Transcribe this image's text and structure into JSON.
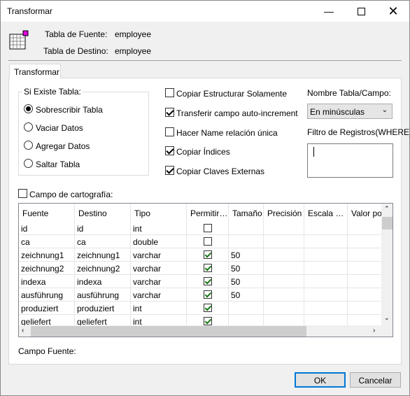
{
  "window": {
    "title": "Transformar",
    "minimize_icon": "minimize-icon",
    "maximize_icon": "maximize-icon",
    "close_icon": "close-icon"
  },
  "header": {
    "icon": "table-icon",
    "source_label": "Tabla de Fuente:",
    "source_value": "employee",
    "dest_label": "Tabla de Destino:",
    "dest_value": "employee"
  },
  "tabs": [
    {
      "label": "Transformar",
      "active": true
    }
  ],
  "if_exists": {
    "label": "Si Existe Tabla:",
    "options": [
      {
        "label": "Sobrescribir Tabla",
        "selected": true
      },
      {
        "label": "Vaciar Datos",
        "selected": false
      },
      {
        "label": "Agregar Datos",
        "selected": false
      },
      {
        "label": "Saltar Tabla",
        "selected": false
      }
    ]
  },
  "options": [
    {
      "label": "Copiar Estructurar Solamente",
      "checked": false
    },
    {
      "label": "Transferir campo auto-increment",
      "checked": true
    },
    {
      "label": "Hacer Name relación única",
      "checked": false
    },
    {
      "label": "Copiar Índices",
      "checked": true
    },
    {
      "label": "Copiar Claves Externas",
      "checked": true
    }
  ],
  "name_case": {
    "label": "Nombre Tabla/Campo:",
    "value": "En minúsculas"
  },
  "filter": {
    "label": "Filtro de Registros(WHERE):",
    "value": ""
  },
  "mapping": {
    "label": "Campo de cartografía:",
    "checked": false
  },
  "grid": {
    "columns": [
      "Fuente",
      "Destino",
      "Tipo",
      "Permitir…",
      "Tamaño",
      "Precisión",
      "Escala …",
      "Valor pot"
    ],
    "rows": [
      {
        "fuente": "id",
        "destino": "id",
        "tipo": "int",
        "permitir": false,
        "tamano": ""
      },
      {
        "fuente": "ca",
        "destino": "ca",
        "tipo": "double",
        "permitir": false,
        "tamano": ""
      },
      {
        "fuente": "zeichnung1",
        "destino": "zeichnung1",
        "tipo": "varchar",
        "permitir": true,
        "tamano": "50"
      },
      {
        "fuente": "zeichnung2",
        "destino": "zeichnung2",
        "tipo": "varchar",
        "permitir": true,
        "tamano": "50"
      },
      {
        "fuente": "indexa",
        "destino": "indexa",
        "tipo": "varchar",
        "permitir": true,
        "tamano": "50"
      },
      {
        "fuente": "ausführung",
        "destino": "ausführung",
        "tipo": "varchar",
        "permitir": true,
        "tamano": "50"
      },
      {
        "fuente": "produziert",
        "destino": "produziert",
        "tipo": "int",
        "permitir": true,
        "tamano": ""
      },
      {
        "fuente": "geliefert",
        "destino": "geliefert",
        "tipo": "int",
        "permitir": true,
        "tamano": ""
      }
    ]
  },
  "footer": {
    "source_field_label": "Campo Fuente:",
    "ok": "OK",
    "cancel": "Cancelar"
  }
}
